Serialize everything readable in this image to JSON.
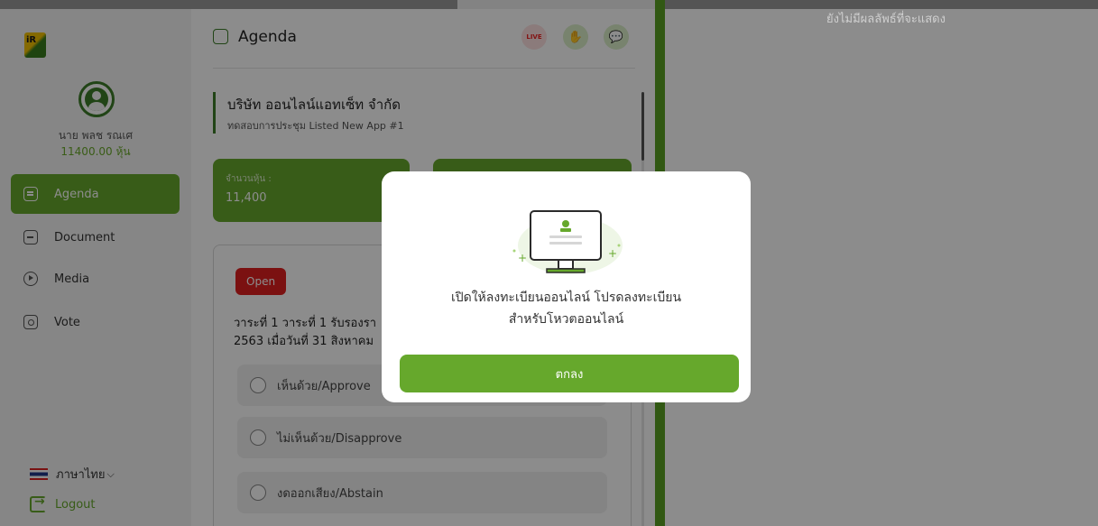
{
  "brand": {
    "logo_text": "iR"
  },
  "user": {
    "name": "นาย พลช รณเศ",
    "shares": "11400.00 หุ้น"
  },
  "sidebar": {
    "items": [
      {
        "label": "Agenda",
        "icon": "agenda-icon",
        "active": true
      },
      {
        "label": "Document",
        "icon": "document-icon",
        "active": false
      },
      {
        "label": "Media",
        "icon": "media-icon",
        "active": false
      },
      {
        "label": "Vote",
        "icon": "vote-icon",
        "active": false
      }
    ],
    "language": "ภาษาไทย",
    "logout": "Logout"
  },
  "header": {
    "title": "Agenda",
    "live_label": "LIVE"
  },
  "company": {
    "name": "บริษัท ออนไลน์แอทเซ็ท จำกัด",
    "meeting": "ทดสอบการประชุม Listed New App #1"
  },
  "share_card": {
    "label": "จำนวนหุ้น :",
    "value": "11,400"
  },
  "agenda": {
    "status": "Open",
    "line1": "วาระที่ 1 วาระที่ 1 รับรองรา",
    "line2": "2563 เมื่อวันที่ 31 สิงหาคม",
    "options": [
      "เห็นด้วย/Approve",
      "ไม่เห็นด้วย/Disapprove",
      "งดออกเสียง/Abstain"
    ]
  },
  "right_panel": {
    "empty_text": "ยังไม่มีผลลัพธ์ที่จะแสดง"
  },
  "modal": {
    "message_line1": "เปิดให้ลงทะเบียนออนไลน์ โปรดลงทะเบียน",
    "message_line2": "สำหรับโหวตออนไลน์",
    "ok_label": "ตกลง"
  },
  "colors": {
    "accent": "#66a82c",
    "accent_dark": "#3d7d28",
    "danger": "#e02020"
  }
}
